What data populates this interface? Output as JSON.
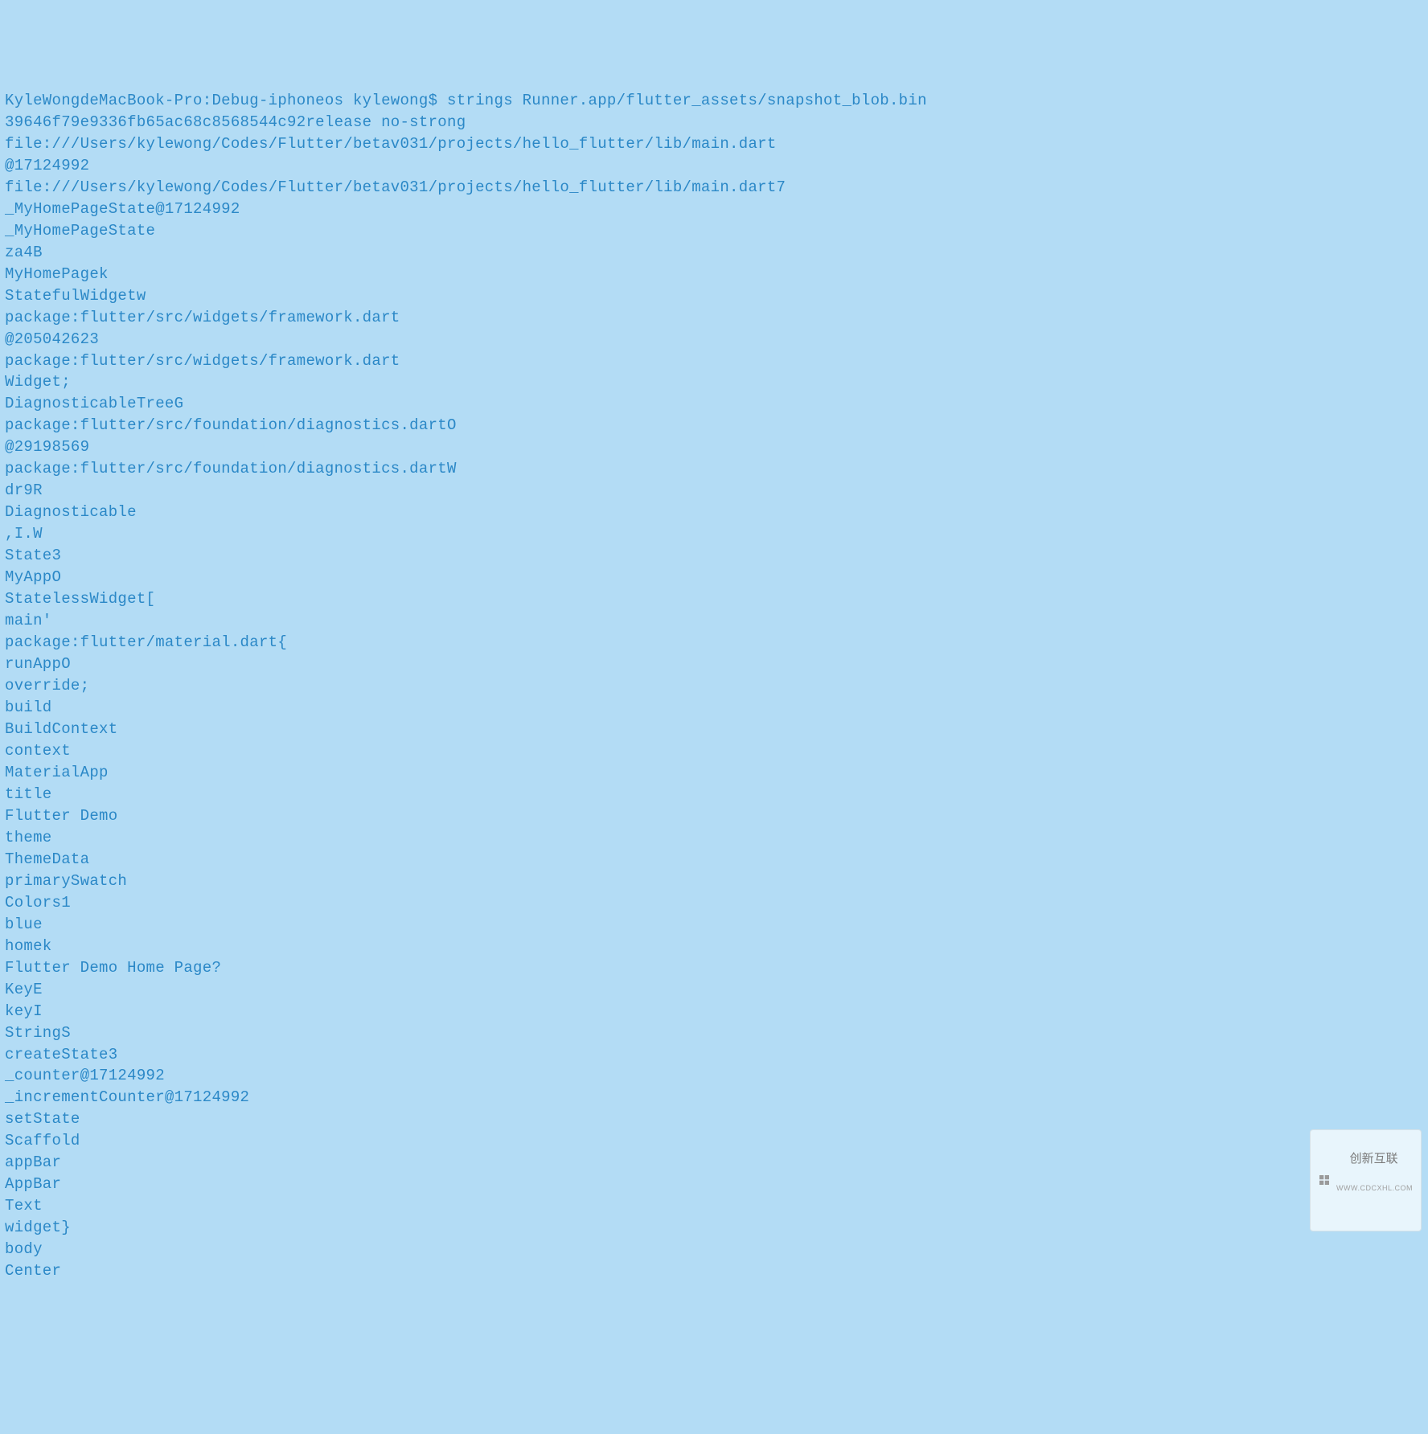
{
  "terminal": {
    "lines": [
      "KyleWongdeMacBook-Pro:Debug-iphoneos kylewong$ strings Runner.app/flutter_assets/snapshot_blob.bin",
      "39646f79e9336fb65ac68c8568544c92release no-strong",
      "file:///Users/kylewong/Codes/Flutter/betav031/projects/hello_flutter/lib/main.dart",
      "@17124992",
      "file:///Users/kylewong/Codes/Flutter/betav031/projects/hello_flutter/lib/main.dart7",
      "_MyHomePageState@17124992",
      "_MyHomePageState",
      "za4B",
      "MyHomePagek",
      "StatefulWidgetw",
      "package:flutter/src/widgets/framework.dart",
      "@205042623",
      "package:flutter/src/widgets/framework.dart",
      "Widget;",
      "DiagnosticableTreeG",
      "package:flutter/src/foundation/diagnostics.dartO",
      "@29198569",
      "package:flutter/src/foundation/diagnostics.dartW",
      "dr9R",
      "Diagnosticable",
      ",I.W",
      "State3",
      "MyAppO",
      "StatelessWidget[",
      "main'",
      "package:flutter/material.dart{",
      "runAppO",
      "override;",
      "build",
      "BuildContext",
      "context",
      "MaterialApp",
      "title",
      "Flutter Demo",
      "theme",
      "ThemeData",
      "primarySwatch",
      "Colors1",
      "blue",
      "homek",
      "Flutter Demo Home Page?",
      "KeyE",
      "keyI",
      "StringS",
      "createState3",
      "_counter@17124992",
      "_incrementCounter@17124992",
      "setState",
      "Scaffold",
      "appBar",
      "AppBar",
      "Text",
      "widget}",
      "body",
      "Center"
    ]
  },
  "watermark": {
    "brand": "创新互联",
    "sub": "WWW.CDCXHL.COM"
  }
}
